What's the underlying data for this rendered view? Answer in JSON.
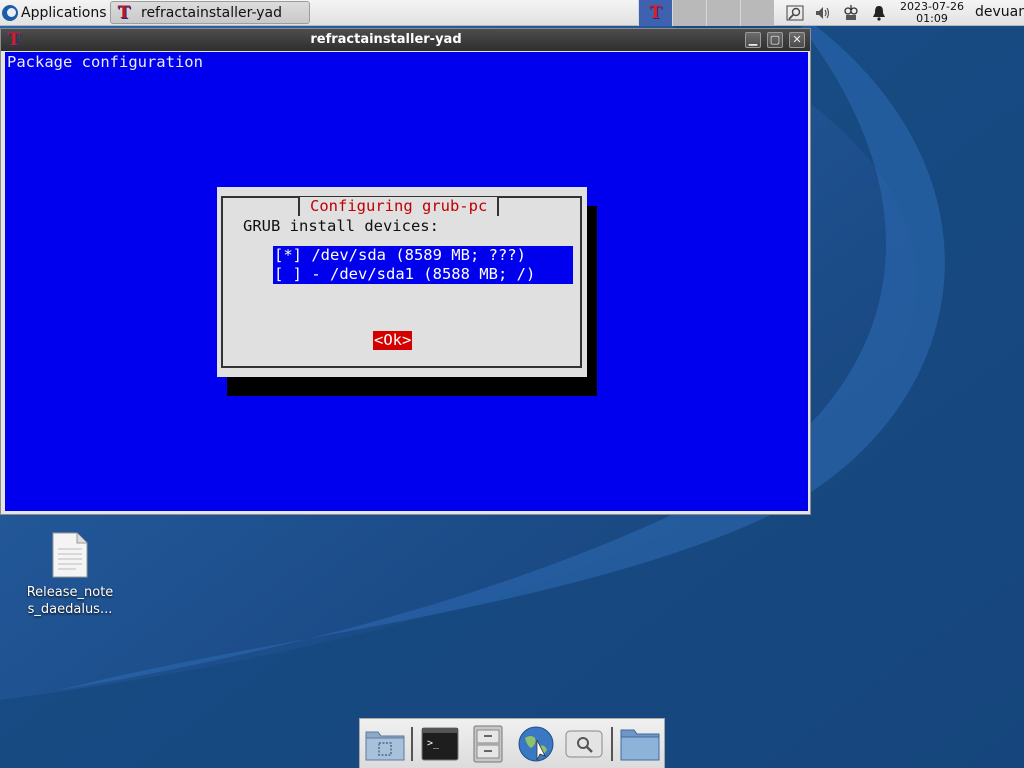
{
  "top_panel": {
    "applications_label": "Applications",
    "applications_separator": "⁝",
    "task_button_label": "refractainstaller-yad",
    "clock_date": "2023-07-26",
    "clock_time": "01:09",
    "username": "devuan"
  },
  "window": {
    "title": "refractainstaller-yad",
    "minimize_glyph": "▁",
    "maximize_glyph": "▢",
    "close_glyph": "✕"
  },
  "terminal": {
    "header": "Package configuration"
  },
  "dialog": {
    "title": "Configuring grub-pc",
    "prompt": "GRUB install devices:",
    "options": [
      {
        "label": "[*] /dev/sda (8589 MB; ???)",
        "checked": true
      },
      {
        "label": "[ ] - /dev/sda1 (8588 MB; /)",
        "checked": false
      }
    ],
    "ok_label": "<Ok>"
  },
  "desktop_icons": [
    {
      "label_line1": "Release_note",
      "label_line2": "s_daedalus...",
      "icon": "text-file-icon"
    }
  ],
  "dock": {
    "items": [
      {
        "icon": "show-desktop-icon"
      },
      {
        "icon": "terminal-icon"
      },
      {
        "icon": "file-manager-icon"
      },
      {
        "icon": "web-browser-icon"
      },
      {
        "icon": "app-finder-icon"
      },
      {
        "icon": "home-folder-icon"
      }
    ]
  },
  "colors": {
    "terminal_bg": "#0000ee",
    "dialog_bg": "#e0e0e0",
    "dialog_title": "#c00000",
    "ok_button_bg": "#d40000",
    "desktop_bg": "#1d4f8e"
  }
}
